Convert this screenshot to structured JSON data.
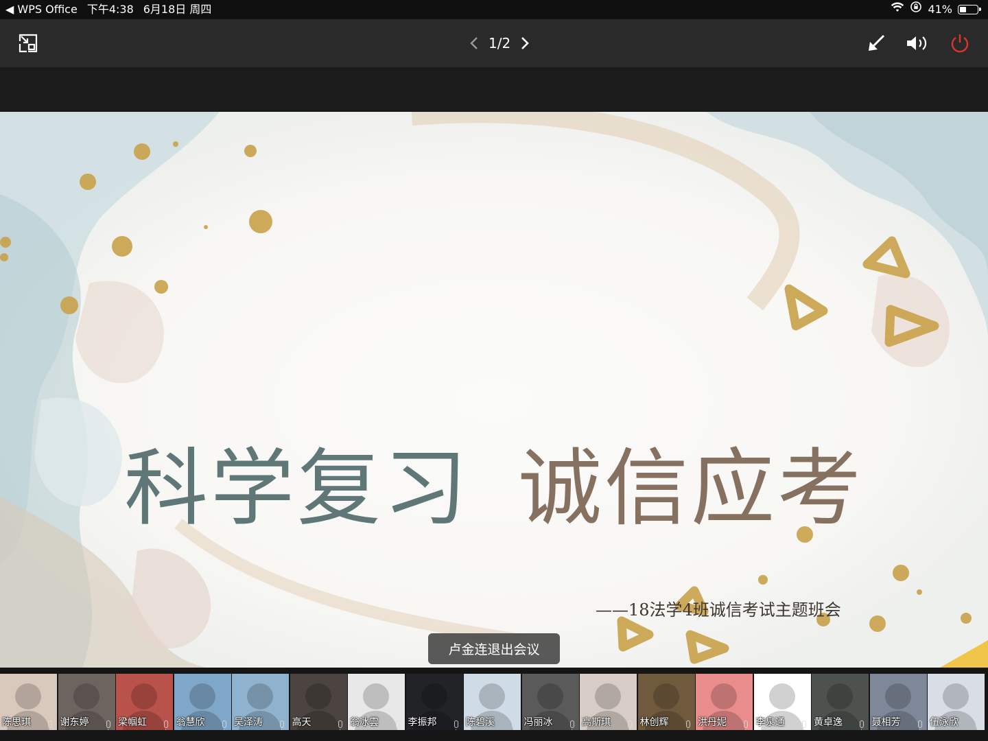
{
  "status_bar": {
    "back_app": "◀ WPS Office",
    "time": "下午4:38",
    "date": "6月18日 周四",
    "battery": "41%",
    "battery_level": 0.41
  },
  "toolbar": {
    "page_indicator": "1/2",
    "icons": [
      "exit-fullscreen-icon",
      "chevron-left-icon",
      "chevron-right-icon",
      "pointer-arrow-icon",
      "speaker-icon",
      "power-icon"
    ],
    "power_color": "#e0332a"
  },
  "slide": {
    "title_part1": "科学复习",
    "title_part2": "诚信应考",
    "subtitle": "——18法学4班诚信考试主题班会",
    "colors": {
      "title1": "#5f7877",
      "title2": "#86705f",
      "gold": "#c9a24a"
    }
  },
  "toast": "卢金连退出会议",
  "participants": [
    {
      "name": "陈思琪",
      "color": "#d9c9bd"
    },
    {
      "name": "谢东婷",
      "color": "#6d6460"
    },
    {
      "name": "梁帼虹",
      "color": "#b9524a"
    },
    {
      "name": "翁慧欣",
      "color": "#7fa7c9"
    },
    {
      "name": "吴泽涛",
      "color": "#8fb3cf"
    },
    {
      "name": "高天",
      "color": "#4b4440"
    },
    {
      "name": "翁冰雲",
      "color": "#e8e8e8"
    },
    {
      "name": "李振邦",
      "color": "#222326"
    },
    {
      "name": "陈碧溪",
      "color": "#cfdbe6"
    },
    {
      "name": "冯丽冰",
      "color": "#5a5a5a"
    },
    {
      "name": "高斯琪",
      "color": "#d8cdc6"
    },
    {
      "name": "林创辉",
      "color": "#6f5a3d"
    },
    {
      "name": "洪丹妮",
      "color": "#e98c8c"
    },
    {
      "name": "李泉通",
      "color": "#ffffff"
    },
    {
      "name": "黄卓逸",
      "color": "#4d524f"
    },
    {
      "name": "聂相芳",
      "color": "#7e8898"
    },
    {
      "name": "伍泳欣",
      "color": "#d8dde6"
    }
  ]
}
